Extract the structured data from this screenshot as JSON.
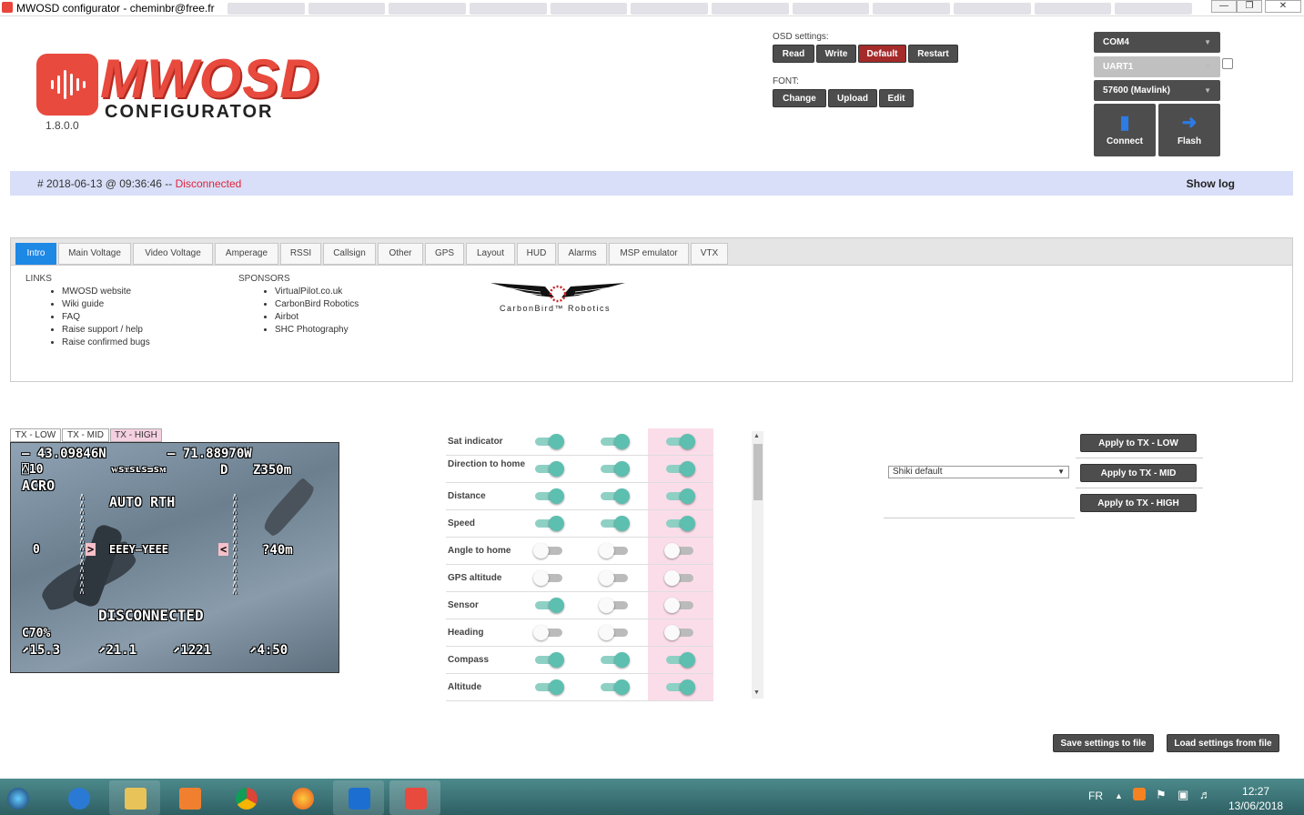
{
  "window": {
    "title": "MWOSD configurator - cheminbr@free.fr",
    "controls": [
      "—",
      "❐",
      "✕"
    ]
  },
  "logo": {
    "brand": "MWOSD",
    "subtitle": "CONFIGURATOR",
    "version": "1.8.0.0"
  },
  "osd_settings": {
    "label": "OSD settings:",
    "buttons": [
      "Read",
      "Write",
      "Default",
      "Restart"
    ]
  },
  "font": {
    "label": "FONT:",
    "buttons": [
      "Change",
      "Upload",
      "Edit"
    ]
  },
  "connection": {
    "port": "COM4",
    "uart": "UART1",
    "baud": "57600 (Mavlink)",
    "connect_label": "Connect",
    "flash_label": "Flash"
  },
  "status": {
    "timestamp": "# 2018-06-13 @ 09:36:46 --",
    "state": "Disconnected",
    "show_log": "Show log"
  },
  "tabs": [
    "Intro",
    "Main Voltage",
    "Video Voltage",
    "Amperage",
    "RSSI",
    "Callsign",
    "Other",
    "GPS",
    "Layout",
    "HUD",
    "Alarms",
    "MSP emulator",
    "VTX"
  ],
  "intro": {
    "links_heading": "LINKS",
    "links": [
      "MWOSD website",
      "Wiki guide",
      "FAQ",
      "Raise support / help",
      "Raise confirmed bugs"
    ],
    "sponsors_heading": "SPONSORS",
    "sponsors": [
      "VirtualPilot.co.uk",
      "CarbonBird Robotics",
      "Airbot",
      "SHC Photography"
    ],
    "sponsor_logo_text": "CarbonBird™ Robotics"
  },
  "preview": {
    "tabs": [
      "TX - LOW",
      "TX - MID",
      "TX - HIGH"
    ],
    "active_tab": "TX - HIGH",
    "osd": {
      "lat": "— 43.09846N",
      "lon": "— 71.88970W",
      "sats": "10",
      "rssi_bar": "ᴡsᴛsʟsᴝsᴍ",
      "dir": "D",
      "alt": "Z350m",
      "mode": "ACRO",
      "rth": "AUTO RTH",
      "left_val": "0",
      "right_val": "?40m",
      "horizon": "EEEY—YEEE",
      "disconnected": "DISCONNECTED",
      "throttle": "C70%",
      "volt": "15.3",
      "amp": "21.1",
      "mah": "1221",
      "time": "4:50"
    }
  },
  "elements": [
    {
      "name": "Sat indicator",
      "low": true,
      "mid": true,
      "high": true
    },
    {
      "name": "Direction to home",
      "low": true,
      "mid": true,
      "high": true
    },
    {
      "name": "Distance",
      "low": true,
      "mid": true,
      "high": true
    },
    {
      "name": "Speed",
      "low": true,
      "mid": true,
      "high": true
    },
    {
      "name": "Angle to home",
      "low": false,
      "mid": false,
      "high": false
    },
    {
      "name": "GPS altitude",
      "low": false,
      "mid": false,
      "high": false
    },
    {
      "name": "Sensor",
      "low": true,
      "mid": false,
      "high": false
    },
    {
      "name": "Heading",
      "low": false,
      "mid": false,
      "high": false
    },
    {
      "name": "Compass",
      "low": true,
      "mid": true,
      "high": true
    },
    {
      "name": "Altitude",
      "low": true,
      "mid": true,
      "high": true
    }
  ],
  "layout": {
    "selected": "Shiki default",
    "apply_buttons": [
      "Apply to TX - LOW",
      "Apply to TX - MID",
      "Apply to TX - HIGH"
    ]
  },
  "file_buttons": {
    "save": "Save settings to file",
    "load": "Load settings from file"
  },
  "taskbar": {
    "lang": "FR",
    "time": "12:27",
    "date": "13/06/2018"
  },
  "colors": {
    "accent": "#1e88e5",
    "brand": "#e84a3e",
    "danger": "#a52a2a",
    "toggle_on": "#5cbfb0",
    "status_bg": "#d9dff8"
  }
}
